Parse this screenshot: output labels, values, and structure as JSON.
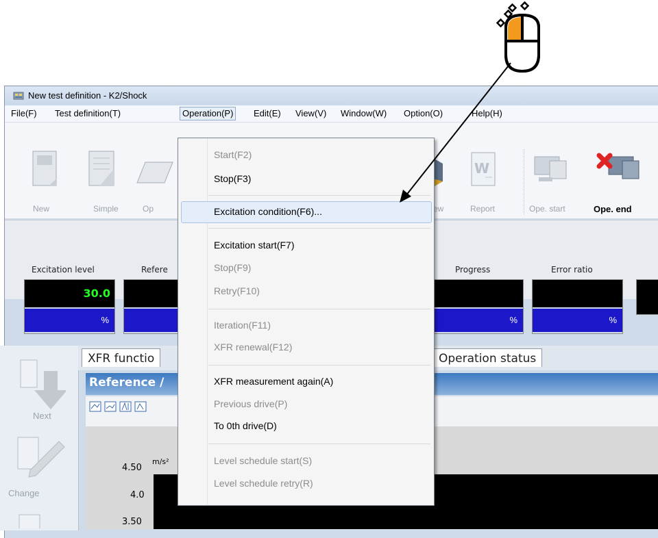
{
  "window": {
    "title": "New test definition - K2/Shock"
  },
  "menubar": {
    "items": [
      "File(F)",
      "Test definition(T)",
      "Operation(P)",
      "Edit(E)",
      "View(V)",
      "Window(W)",
      "Option(O)",
      "Help(H)"
    ],
    "active": "Operation(P)"
  },
  "toolbar": {
    "buttons": [
      "New",
      "Simple",
      "Op",
      "ew",
      "Report",
      "Ope. start",
      "Ope. end"
    ]
  },
  "meters": {
    "labels": [
      "Excitation level",
      "Refere",
      "Progress",
      "Error ratio"
    ],
    "excitation_value": "30.0",
    "unit": "%"
  },
  "side_panel": {
    "items": [
      "Next",
      "Change"
    ]
  },
  "tabs": {
    "items": [
      "XFR functio",
      "Operation status"
    ]
  },
  "graph": {
    "title": "Reference /",
    "y_unit": "m/s²",
    "y_ticks": [
      "4.50",
      "4.0",
      "3.50"
    ]
  },
  "dropdown": {
    "items": [
      {
        "label": "Start(F2)",
        "enabled": false
      },
      {
        "label": "Stop(F3)",
        "enabled": true
      },
      {
        "label": "Excitation condition(F6)...",
        "enabled": true,
        "highlighted": true
      },
      {
        "label": "Excitation start(F7)",
        "enabled": true
      },
      {
        "label": "Stop(F9)",
        "enabled": false
      },
      {
        "label": "Retry(F10)",
        "enabled": false
      },
      {
        "label": "Iteration(F11)",
        "enabled": false
      },
      {
        "label": "XFR renewal(F12)",
        "enabled": false
      },
      {
        "label": "XFR measurement again(A)",
        "enabled": true
      },
      {
        "label": "Previous drive(P)",
        "enabled": false
      },
      {
        "label": "To 0th drive(D)",
        "enabled": true
      },
      {
        "label": "Level schedule start(S)",
        "enabled": false
      },
      {
        "label": "Level schedule retry(R)",
        "enabled": false
      }
    ]
  },
  "colors": {
    "meter_value": "#22ff22",
    "meter_unit_bg": "#1c18c9",
    "graph_header": "#3c79c1",
    "mouse_button": "#f39a1e"
  },
  "annotation": {
    "icon": "mouse-left-click-icon"
  }
}
